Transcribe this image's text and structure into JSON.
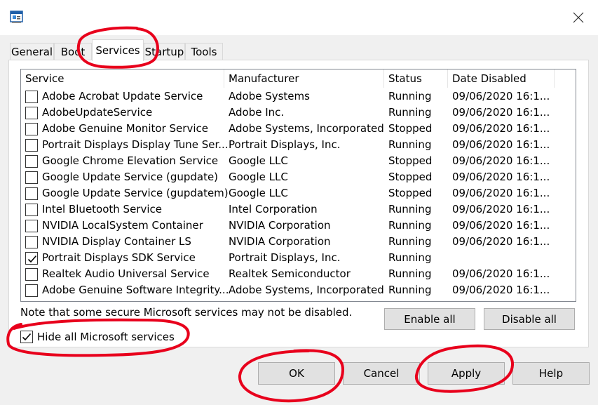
{
  "window": {
    "app_icon": "msconfig-icon",
    "close_icon": "close-icon"
  },
  "tabs": [
    {
      "label": "General"
    },
    {
      "label": "Boot"
    },
    {
      "label": "Services"
    },
    {
      "label": "Startup"
    },
    {
      "label": "Tools"
    }
  ],
  "active_tab": "Services",
  "services": {
    "columns": [
      "Service",
      "Manufacturer",
      "Status",
      "Date Disabled"
    ],
    "rows": [
      {
        "checked": false,
        "service": "Adobe Acrobat Update Service",
        "manufacturer": "Adobe Systems",
        "status": "Running",
        "date": "09/06/2020 16:1..."
      },
      {
        "checked": false,
        "service": "AdobeUpdateService",
        "manufacturer": "Adobe Inc.",
        "status": "Running",
        "date": "09/06/2020 16:1..."
      },
      {
        "checked": false,
        "service": "Adobe Genuine Monitor Service",
        "manufacturer": "Adobe Systems, Incorporated",
        "status": "Stopped",
        "date": "09/06/2020 16:1..."
      },
      {
        "checked": false,
        "service": "Portrait Displays Display Tune Ser...",
        "manufacturer": "Portrait Displays, Inc.",
        "status": "Running",
        "date": "09/06/2020 16:1..."
      },
      {
        "checked": false,
        "service": "Google Chrome Elevation Service",
        "manufacturer": "Google LLC",
        "status": "Stopped",
        "date": "09/06/2020 16:1..."
      },
      {
        "checked": false,
        "service": "Google Update Service (gupdate)",
        "manufacturer": "Google LLC",
        "status": "Stopped",
        "date": "09/06/2020 16:1..."
      },
      {
        "checked": false,
        "service": "Google Update Service (gupdatem)",
        "manufacturer": "Google LLC",
        "status": "Stopped",
        "date": "09/06/2020 16:1..."
      },
      {
        "checked": false,
        "service": "Intel Bluetooth Service",
        "manufacturer": "Intel Corporation",
        "status": "Running",
        "date": "09/06/2020 16:1..."
      },
      {
        "checked": false,
        "service": "NVIDIA LocalSystem Container",
        "manufacturer": "NVIDIA Corporation",
        "status": "Running",
        "date": "09/06/2020 16:1..."
      },
      {
        "checked": false,
        "service": "NVIDIA Display Container LS",
        "manufacturer": "NVIDIA Corporation",
        "status": "Running",
        "date": "09/06/2020 16:1..."
      },
      {
        "checked": true,
        "service": "Portrait Displays SDK Service",
        "manufacturer": "Portrait Displays, Inc.",
        "status": "Running",
        "date": ""
      },
      {
        "checked": false,
        "service": "Realtek Audio Universal Service",
        "manufacturer": "Realtek Semiconductor",
        "status": "Running",
        "date": "09/06/2020 16:1..."
      },
      {
        "checked": false,
        "service": "Adobe Genuine Software Integrity...",
        "manufacturer": "Adobe Systems, Incorporated",
        "status": "Running",
        "date": "09/06/2020 16:1..."
      }
    ],
    "note": "Note that some secure Microsoft services may not be disabled.",
    "enable_all": "Enable all",
    "disable_all": "Disable all",
    "hide_ms_label": "Hide all Microsoft services",
    "hide_ms_checked": true
  },
  "footer": {
    "ok": "OK",
    "cancel": "Cancel",
    "apply": "Apply",
    "help": "Help"
  },
  "colors": {
    "annotation": "#e8001c",
    "window_bg": "#f0f0f0",
    "list_bg": "#ffffff",
    "button_bg": "#e1e1e1"
  }
}
